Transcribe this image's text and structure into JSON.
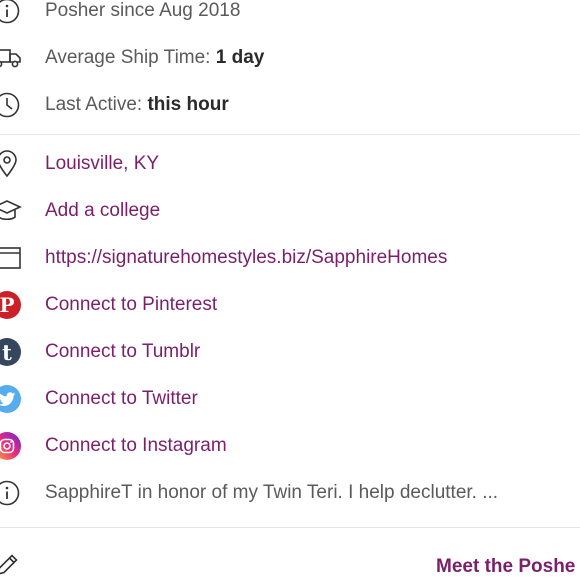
{
  "profile_info": {
    "member_since": "Posher since Aug 2018",
    "ship_time_label": "Average Ship Time: ",
    "ship_time_value": "1 day",
    "last_active_label": "Last Active: ",
    "last_active_value": "this hour"
  },
  "links": {
    "location": "Louisville, KY",
    "college": "Add a college",
    "website": "https://signaturehomestyles.biz/SapphireHomes",
    "pinterest": "Connect to Pinterest",
    "tumblr": "Connect to Tumblr",
    "twitter": "Connect to Twitter",
    "instagram": "Connect to Instagram"
  },
  "bio": "SapphireT in honor of my Twin Teri. I help declutter. ...",
  "footer": {
    "meet_label": "Meet the Poshe"
  },
  "icons": {
    "pinterest_glyph": "P",
    "tumblr_glyph": "t"
  },
  "colors": {
    "accent": "#7b1f6a",
    "pinterest": "#cb2027",
    "tumblr": "#36465d",
    "twitter": "#55acee"
  }
}
